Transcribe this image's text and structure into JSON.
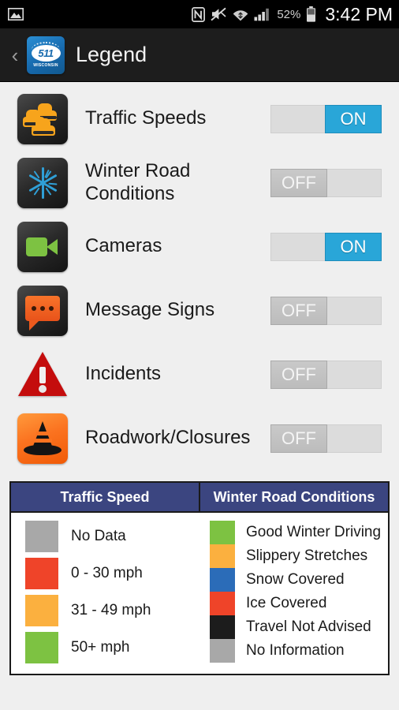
{
  "statusbar": {
    "image_icon": "image-icon",
    "nfc_icon": "nfc-icon",
    "mute_icon": "sound-muted-icon",
    "wifi_icon": "wifi-icon",
    "signal_icon": "cellular-signal-icon",
    "battery_percent": "52%",
    "battery_icon": "battery-icon",
    "clock": "3:42 PM"
  },
  "titlebar": {
    "back_label": "‹",
    "logo_number": "511",
    "logo_state": "WISCONSIN",
    "title": "Legend"
  },
  "layers": [
    {
      "label": "Traffic Speeds",
      "icon": "traffic-cars-icon",
      "state": "ON",
      "state_label": "ON"
    },
    {
      "label": "Winter Road\nConditions",
      "icon": "snowflake-icon",
      "state": "OFF",
      "state_label": "OFF"
    },
    {
      "label": "Cameras",
      "icon": "video-camera-icon",
      "state": "ON",
      "state_label": "ON"
    },
    {
      "label": "Message Signs",
      "icon": "message-bubble-icon",
      "state": "OFF",
      "state_label": "OFF"
    },
    {
      "label": "Incidents",
      "icon": "warning-triangle-icon",
      "state": "OFF",
      "state_label": "OFF"
    },
    {
      "label": "Roadwork/Closures",
      "icon": "traffic-cone-icon",
      "state": "OFF",
      "state_label": "OFF"
    }
  ],
  "legend": {
    "header_left": "Traffic Speed",
    "header_right": "Winter Road Conditions",
    "traffic_speed": [
      {
        "label": "No Data",
        "color": "#a8a8a8"
      },
      {
        "label": "0 - 30 mph",
        "color": "#ef4429"
      },
      {
        "label": "31 - 49 mph",
        "color": "#fbb03f"
      },
      {
        "label": "50+ mph",
        "color": "#7dc242"
      }
    ],
    "winter_conditions": [
      {
        "label": "Good Winter Driving",
        "color": "#7dc242"
      },
      {
        "label": "Slippery Stretches",
        "color": "#fbb03f"
      },
      {
        "label": "Snow Covered",
        "color": "#2b6cb8"
      },
      {
        "label": "Ice Covered",
        "color": "#ef4429"
      },
      {
        "label": "Travel Not Advised",
        "color": "#1c1c1c"
      },
      {
        "label": "No Information",
        "color": "#a8a8a8"
      }
    ]
  },
  "colors": {
    "toggle_on": "#29a6d8",
    "header_navy": "#3b4580",
    "page_background": "#efefef"
  }
}
